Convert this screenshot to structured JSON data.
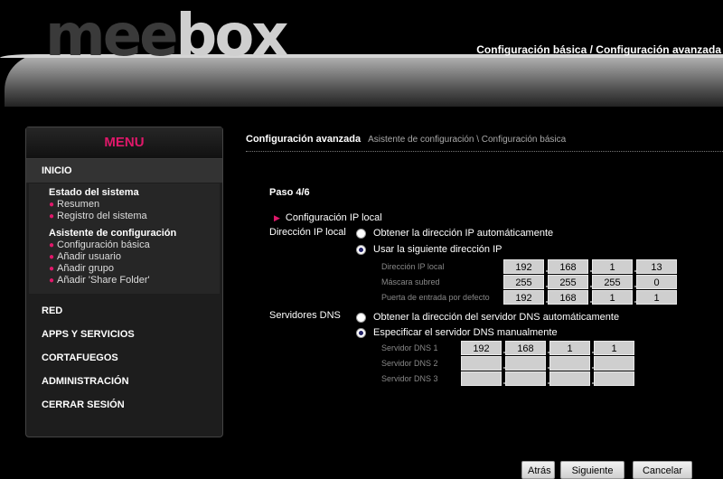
{
  "header": {
    "logo_part1": "mee",
    "logo_part2": "box",
    "nav_basic": "Configuración básica",
    "nav_sep": " / ",
    "nav_advanced": "Configuración avanzada"
  },
  "menu": {
    "title": "MENU",
    "inicio": "INICIO",
    "groups": [
      {
        "title": "Estado del sistema",
        "items": [
          "Resumen",
          "Registro del sistema"
        ]
      },
      {
        "title": "Asistente de configuración",
        "items": [
          "Configuración básica",
          "Añadir usuario",
          "Añadir grupo",
          "Añadir 'Share Folder'"
        ]
      }
    ],
    "main_items": [
      "RED",
      "APPS Y SERVICIOS",
      "CORTAFUEGOS",
      "ADMINISTRACIÓN",
      "CERRAR SESIÓN"
    ]
  },
  "breadcrumb": {
    "current": "Configuración avanzada",
    "path": "Asistente de configuración \\ Configuración básica"
  },
  "step": "Paso 4/6",
  "section": "Configuración IP local",
  "ip": {
    "label": "Dirección IP local",
    "auto_label": "Obtener la dirección IP automáticamente",
    "manual_label": "Usar la siguiente dirección IP",
    "selected": "manual",
    "fields": [
      {
        "label": "Dirección IP local",
        "octets": [
          "192",
          "168",
          "1",
          "13"
        ]
      },
      {
        "label": "Máscara subred",
        "octets": [
          "255",
          "255",
          "255",
          "0"
        ]
      },
      {
        "label": "Puerta de entrada por defecto",
        "octets": [
          "192",
          "168",
          "1",
          "1"
        ]
      }
    ]
  },
  "dns": {
    "label": "Servidores DNS",
    "auto_label": "Obtener la dirección del servidor DNS automáticamente",
    "manual_label": "Especificar el servidor DNS manualmente",
    "selected": "manual",
    "fields": [
      {
        "label": "Servidor DNS 1",
        "octets": [
          "192",
          "168",
          "1",
          "1"
        ]
      },
      {
        "label": "Servidor DNS 2",
        "octets": [
          "",
          "",
          "",
          ""
        ]
      },
      {
        "label": "Servidor DNS 3",
        "octets": [
          "",
          "",
          "",
          ""
        ]
      }
    ]
  },
  "buttons": {
    "back": "Atrás",
    "next": "Siguiente",
    "cancel": "Cancelar"
  },
  "colors": {
    "accent": "#e0186a",
    "background": "#000000"
  }
}
